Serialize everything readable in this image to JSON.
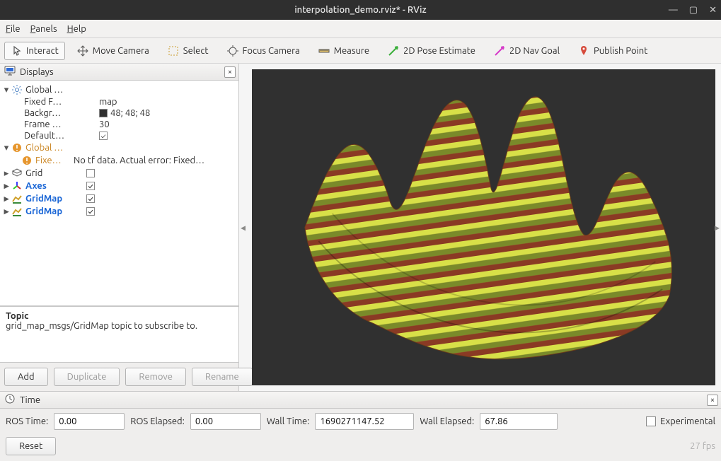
{
  "window": {
    "title": "interpolation_demo.rviz* - RViz"
  },
  "menu": {
    "file": "File",
    "panels": "Panels",
    "help": "Help"
  },
  "toolbar": {
    "interact": "Interact",
    "move_camera": "Move Camera",
    "select": "Select",
    "focus_camera": "Focus Camera",
    "measure": "Measure",
    "pose_estimate": "2D Pose Estimate",
    "nav_goal": "2D Nav Goal",
    "publish_point": "Publish Point"
  },
  "displays": {
    "panel_title": "Displays",
    "tree": {
      "global_options": {
        "label": "Global …"
      },
      "fixed_frame": {
        "label": "Fixed F…",
        "value": "map"
      },
      "background": {
        "label": "Backgr…",
        "value": "48; 48; 48"
      },
      "frame_rate": {
        "label": "Frame …",
        "value": "30"
      },
      "default_light": {
        "label": "Default…",
        "checked": true
      },
      "global_status": {
        "label": "Global …"
      },
      "fixed_status": {
        "label": "Fixe…",
        "value": "No tf data.  Actual error: Fixed…"
      },
      "grid": {
        "label": "Grid",
        "checked": false
      },
      "axes": {
        "label": "Axes",
        "checked": true
      },
      "gridmap1": {
        "label": "GridMap",
        "checked": true
      },
      "gridmap2": {
        "label": "GridMap",
        "checked": true
      }
    },
    "description": {
      "title": "Topic",
      "body": "grid_map_msgs/GridMap topic to subscribe to."
    },
    "buttons": {
      "add": "Add",
      "duplicate": "Duplicate",
      "remove": "Remove",
      "rename": "Rename"
    }
  },
  "time": {
    "panel_title": "Time",
    "ros_time_label": "ROS Time:",
    "ros_time_value": "0.00",
    "ros_elapsed_label": "ROS Elapsed:",
    "ros_elapsed_value": "0.00",
    "wall_time_label": "Wall Time:",
    "wall_time_value": "1690271147.52",
    "wall_elapsed_label": "Wall Elapsed:",
    "wall_elapsed_value": "67.86",
    "experimental": "Experimental"
  },
  "footer": {
    "reset": "Reset",
    "fps": "27 fps"
  },
  "colors": {
    "viewport_bg": "#303030"
  }
}
